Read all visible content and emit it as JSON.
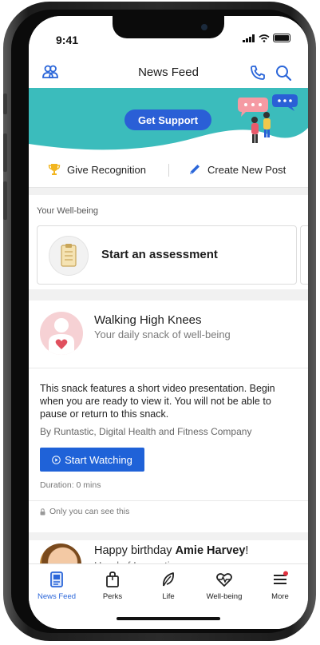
{
  "status_bar": {
    "time": "9:41"
  },
  "header": {
    "title": "News Feed"
  },
  "banner": {
    "button_label": "Get Support"
  },
  "actions": {
    "recognition": "Give Recognition",
    "new_post": "Create New Post"
  },
  "wellbeing": {
    "section_label": "Your Well-being",
    "card_title": "Start an assessment"
  },
  "snack": {
    "title": "Walking High Knees",
    "subtitle": "Your daily snack of well-being",
    "description": "This snack features a short video presentation. Begin when you are ready to view it. You will not be able to pause or return to this snack.",
    "byline": "By Runtastic, Digital Health and Fitness Company",
    "button_label": "Start Watching",
    "duration": "Duration: 0 mins",
    "privacy": "Only you can see this"
  },
  "birthday": {
    "prefix": "Happy birthday ",
    "name": "Amie Harvey",
    "suffix": "!",
    "subtitle": "Head of Innovations"
  },
  "tabs": [
    {
      "label": "News Feed",
      "icon": "news-feed-icon",
      "active": true
    },
    {
      "label": "Perks",
      "icon": "bag-icon",
      "active": false
    },
    {
      "label": "Life",
      "icon": "leaf-icon",
      "active": false
    },
    {
      "label": "Well-being",
      "icon": "heartbeat-icon",
      "active": false
    },
    {
      "label": "More",
      "icon": "menu-icon",
      "active": false
    }
  ],
  "colors": {
    "accent": "#2b66d9",
    "banner": "#3bbcbc",
    "button": "#1f62d8"
  }
}
